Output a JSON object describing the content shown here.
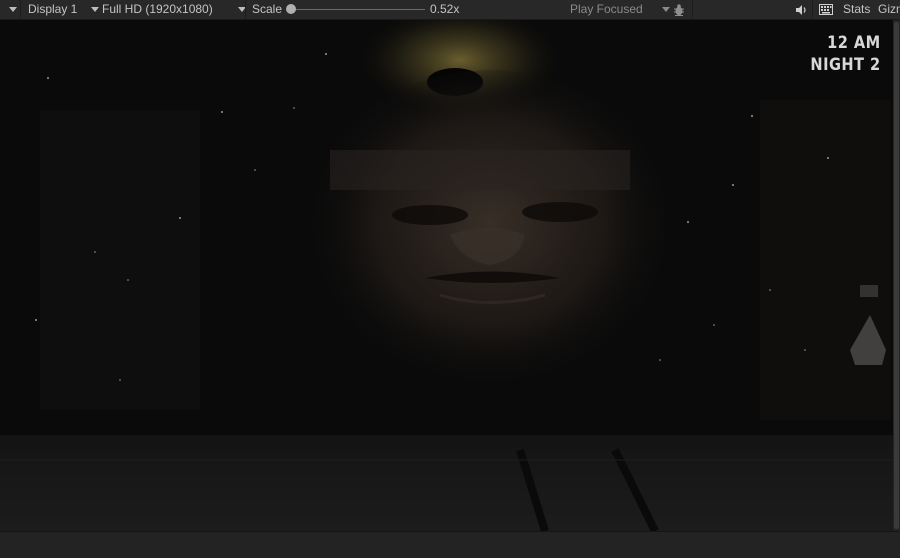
{
  "toolbar": {
    "display_dropdown": "Display 1",
    "resolution_dropdown": "Full HD (1920x1080)",
    "scale_label": "Scale",
    "scale_value_text": "0.52x",
    "scale_level": 0.0,
    "play_mode_dropdown": "Play Focused",
    "stats_label": "Stats",
    "gizmos_label": "Gizmos",
    "icons": {
      "menu": "chevron-down-icon",
      "bug": "bug-icon",
      "audio": "speaker-icon",
      "keyboard": "keyboard-icon"
    }
  },
  "game": {
    "time": "12 AM",
    "night": "NIGHT 2"
  },
  "colors": {
    "toolbar_bg": "#282828",
    "toolbar_text": "#c4c4c4",
    "viewport_bg": "#0b0b0b",
    "hud_text": "#d8d8d8"
  }
}
